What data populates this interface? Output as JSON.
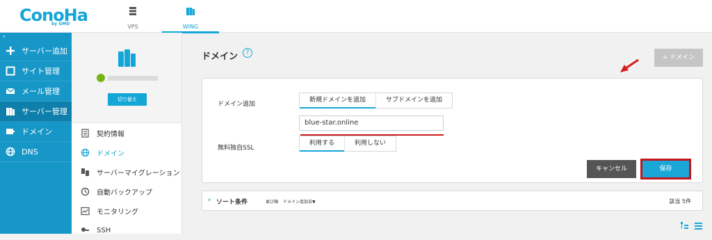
{
  "topbar": {
    "logo": "ConoHa",
    "logo_sub": "by GMO",
    "tabs": [
      {
        "label": "VPS",
        "icon": "server-stack-icon",
        "active": false
      },
      {
        "label": "WING",
        "icon": "wing-server-icon",
        "active": true
      }
    ]
  },
  "sidebar": {
    "collapse": "‹",
    "items": [
      {
        "label": "サーバー追加",
        "icon": "plus-icon"
      },
      {
        "label": "サイト管理",
        "icon": "window-icon"
      },
      {
        "label": "メール管理",
        "icon": "mail-icon"
      },
      {
        "label": "サーバー管理",
        "icon": "server-icon",
        "active": true
      },
      {
        "label": "ドメイン",
        "icon": "domain-card-icon"
      },
      {
        "label": "DNS",
        "icon": "globe-icon"
      }
    ]
  },
  "server_panel": {
    "switch_label": "切り替え",
    "status_color": "#7ab317",
    "menu": [
      {
        "label": "契約情報",
        "icon": "contract-icon"
      },
      {
        "label": "ドメイン",
        "icon": "globe-icon",
        "active": true
      },
      {
        "label": "サーバーマイグレーション",
        "icon": "migration-icon"
      },
      {
        "label": "自動バックアップ",
        "icon": "backup-icon"
      },
      {
        "label": "モニタリング",
        "icon": "monitoring-icon"
      },
      {
        "label": "SSH",
        "icon": "key-icon"
      }
    ]
  },
  "main": {
    "title": "ドメイン",
    "help": "?",
    "add_button": "+ ドメイン",
    "form": {
      "domain_add_label": "ドメイン追加",
      "domain_tabs": [
        "新規ドメインを追加",
        "サブドメインを追加"
      ],
      "domain_value": "blue-star.online",
      "ssl_label": "無料独自SSL",
      "ssl_options": [
        "利用する",
        "利用しない"
      ],
      "cancel": "キャンセル",
      "save": "保存"
    },
    "sort": {
      "label": "ソート条件",
      "order_label": "並び順",
      "order_value": "ドメイン追加日▼",
      "count": "該当 5件"
    }
  },
  "colors": {
    "accent": "#14a6d6",
    "sidebar": "#1797c8",
    "highlight_red": "#c4151c"
  }
}
